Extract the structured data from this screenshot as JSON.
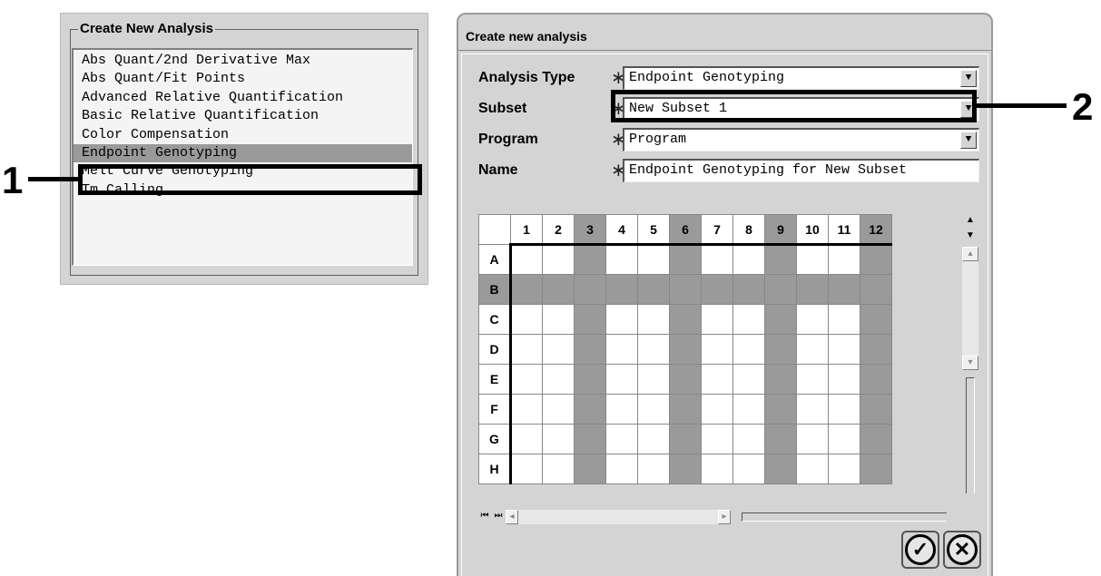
{
  "left_panel": {
    "title": "Create New Analysis",
    "items": [
      {
        "label": "Abs Quant/2nd Derivative Max",
        "selected": false
      },
      {
        "label": "Abs Quant/Fit Points",
        "selected": false
      },
      {
        "label": "Advanced Relative Quantification",
        "selected": false
      },
      {
        "label": "Basic Relative Quantification",
        "selected": false
      },
      {
        "label": "Color Compensation",
        "selected": false
      },
      {
        "label": "Endpoint Genotyping",
        "selected": true
      },
      {
        "label": "Melt Curve Genotyping",
        "selected": false
      },
      {
        "label": "Tm Calling",
        "selected": false
      }
    ]
  },
  "callouts": {
    "one": "1",
    "two": "2"
  },
  "dialog": {
    "title": "Create new analysis",
    "required_marker": "∗",
    "fields": {
      "analysis_type": {
        "label": "Analysis Type",
        "value": "Endpoint Genotyping"
      },
      "subset": {
        "label": "Subset",
        "value": "New Subset 1"
      },
      "program": {
        "label": "Program",
        "value": "Program"
      },
      "name": {
        "label": "Name",
        "value": "Endpoint Genotyping for New Subset"
      }
    },
    "plate": {
      "columns": [
        "1",
        "2",
        "3",
        "4",
        "5",
        "6",
        "7",
        "8",
        "9",
        "10",
        "11",
        "12"
      ],
      "rows": [
        "A",
        "B",
        "C",
        "D",
        "E",
        "F",
        "G",
        "H"
      ],
      "selected_columns": [
        "3",
        "6",
        "9",
        "12"
      ],
      "selected_rows": [
        "B"
      ]
    },
    "icons": {
      "dropdown": "▼",
      "scroll_top": "▲",
      "scroll_bottom": "▼",
      "scroll_up": "▴",
      "scroll_down": "▾",
      "scroll_first": "⏮",
      "scroll_last": "⏭",
      "scroll_left": "◂",
      "scroll_right": "▸",
      "ok": "✓",
      "cancel": "✕"
    }
  }
}
